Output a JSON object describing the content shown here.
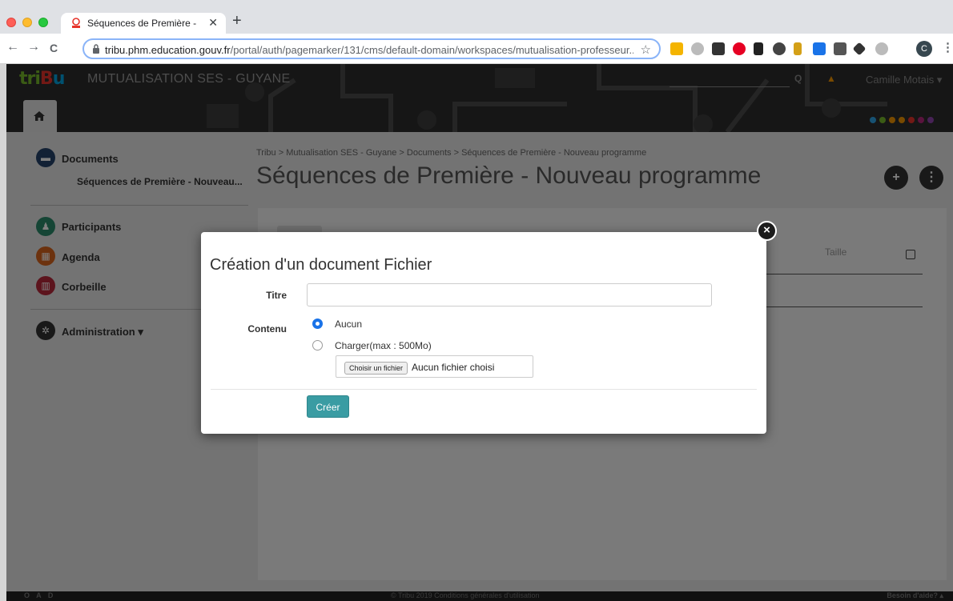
{
  "browser": {
    "tab_title": "Séquences de Première - Nouv",
    "tab_close": "✕",
    "new_tab": "+",
    "url_host": "tribu.phm.education.gouv.fr",
    "url_path": "/portal/auth/pagemarker/131/cms/default-domain/workspaces/mutualisation-professeur...",
    "back_icon": "←",
    "forward_icon": "→",
    "reload_icon": "C",
    "bookmark_icon": "☆",
    "profile_initial": "C",
    "menu_icon": "⋮"
  },
  "header": {
    "logo_part1": "tri",
    "logo_part2": "B",
    "logo_part3": "u",
    "site_title": "MUTUALISATION SES - GUYANE",
    "search_icon": "Q",
    "notification_icon": "▲",
    "user_name": "Camille Motais ▾",
    "dot_colors": [
      "#2fa4e7",
      "#76b82a",
      "#f29400",
      "#f29400",
      "#e6332a",
      "#b4267a",
      "#8e44ad"
    ]
  },
  "sidebar": {
    "documents_label": "Documents",
    "documents_sub": "Séquences de Première - Nouveau...",
    "participants_label": "Participants",
    "agenda_label": "Agenda",
    "trash_label": "Corbeille",
    "admin_label": "Administration ▾"
  },
  "main": {
    "breadcrumb": "Tribu > Mutualisation SES - Guyane > Documents > Séquences de Première - Nouveau programme",
    "title": "Séquences de Première - Nouveau programme",
    "add_button": "+",
    "more_button": "⋮",
    "col_size": "Taille"
  },
  "modal": {
    "title": "Création d'un document Fichier",
    "close": "×",
    "title_label": "Titre",
    "title_value": "",
    "content_label": "Contenu",
    "option_none": "Aucun",
    "option_upload": "Charger(max : 500Mo)",
    "file_button": "Choisir un fichier",
    "file_status": "Aucun fichier choisi",
    "create_button": "Créer"
  },
  "footer": {
    "left": "O A D",
    "center": "© Tribu 2019   Conditions générales d'utilisation",
    "right": "Besoin d'aide? ▴"
  }
}
